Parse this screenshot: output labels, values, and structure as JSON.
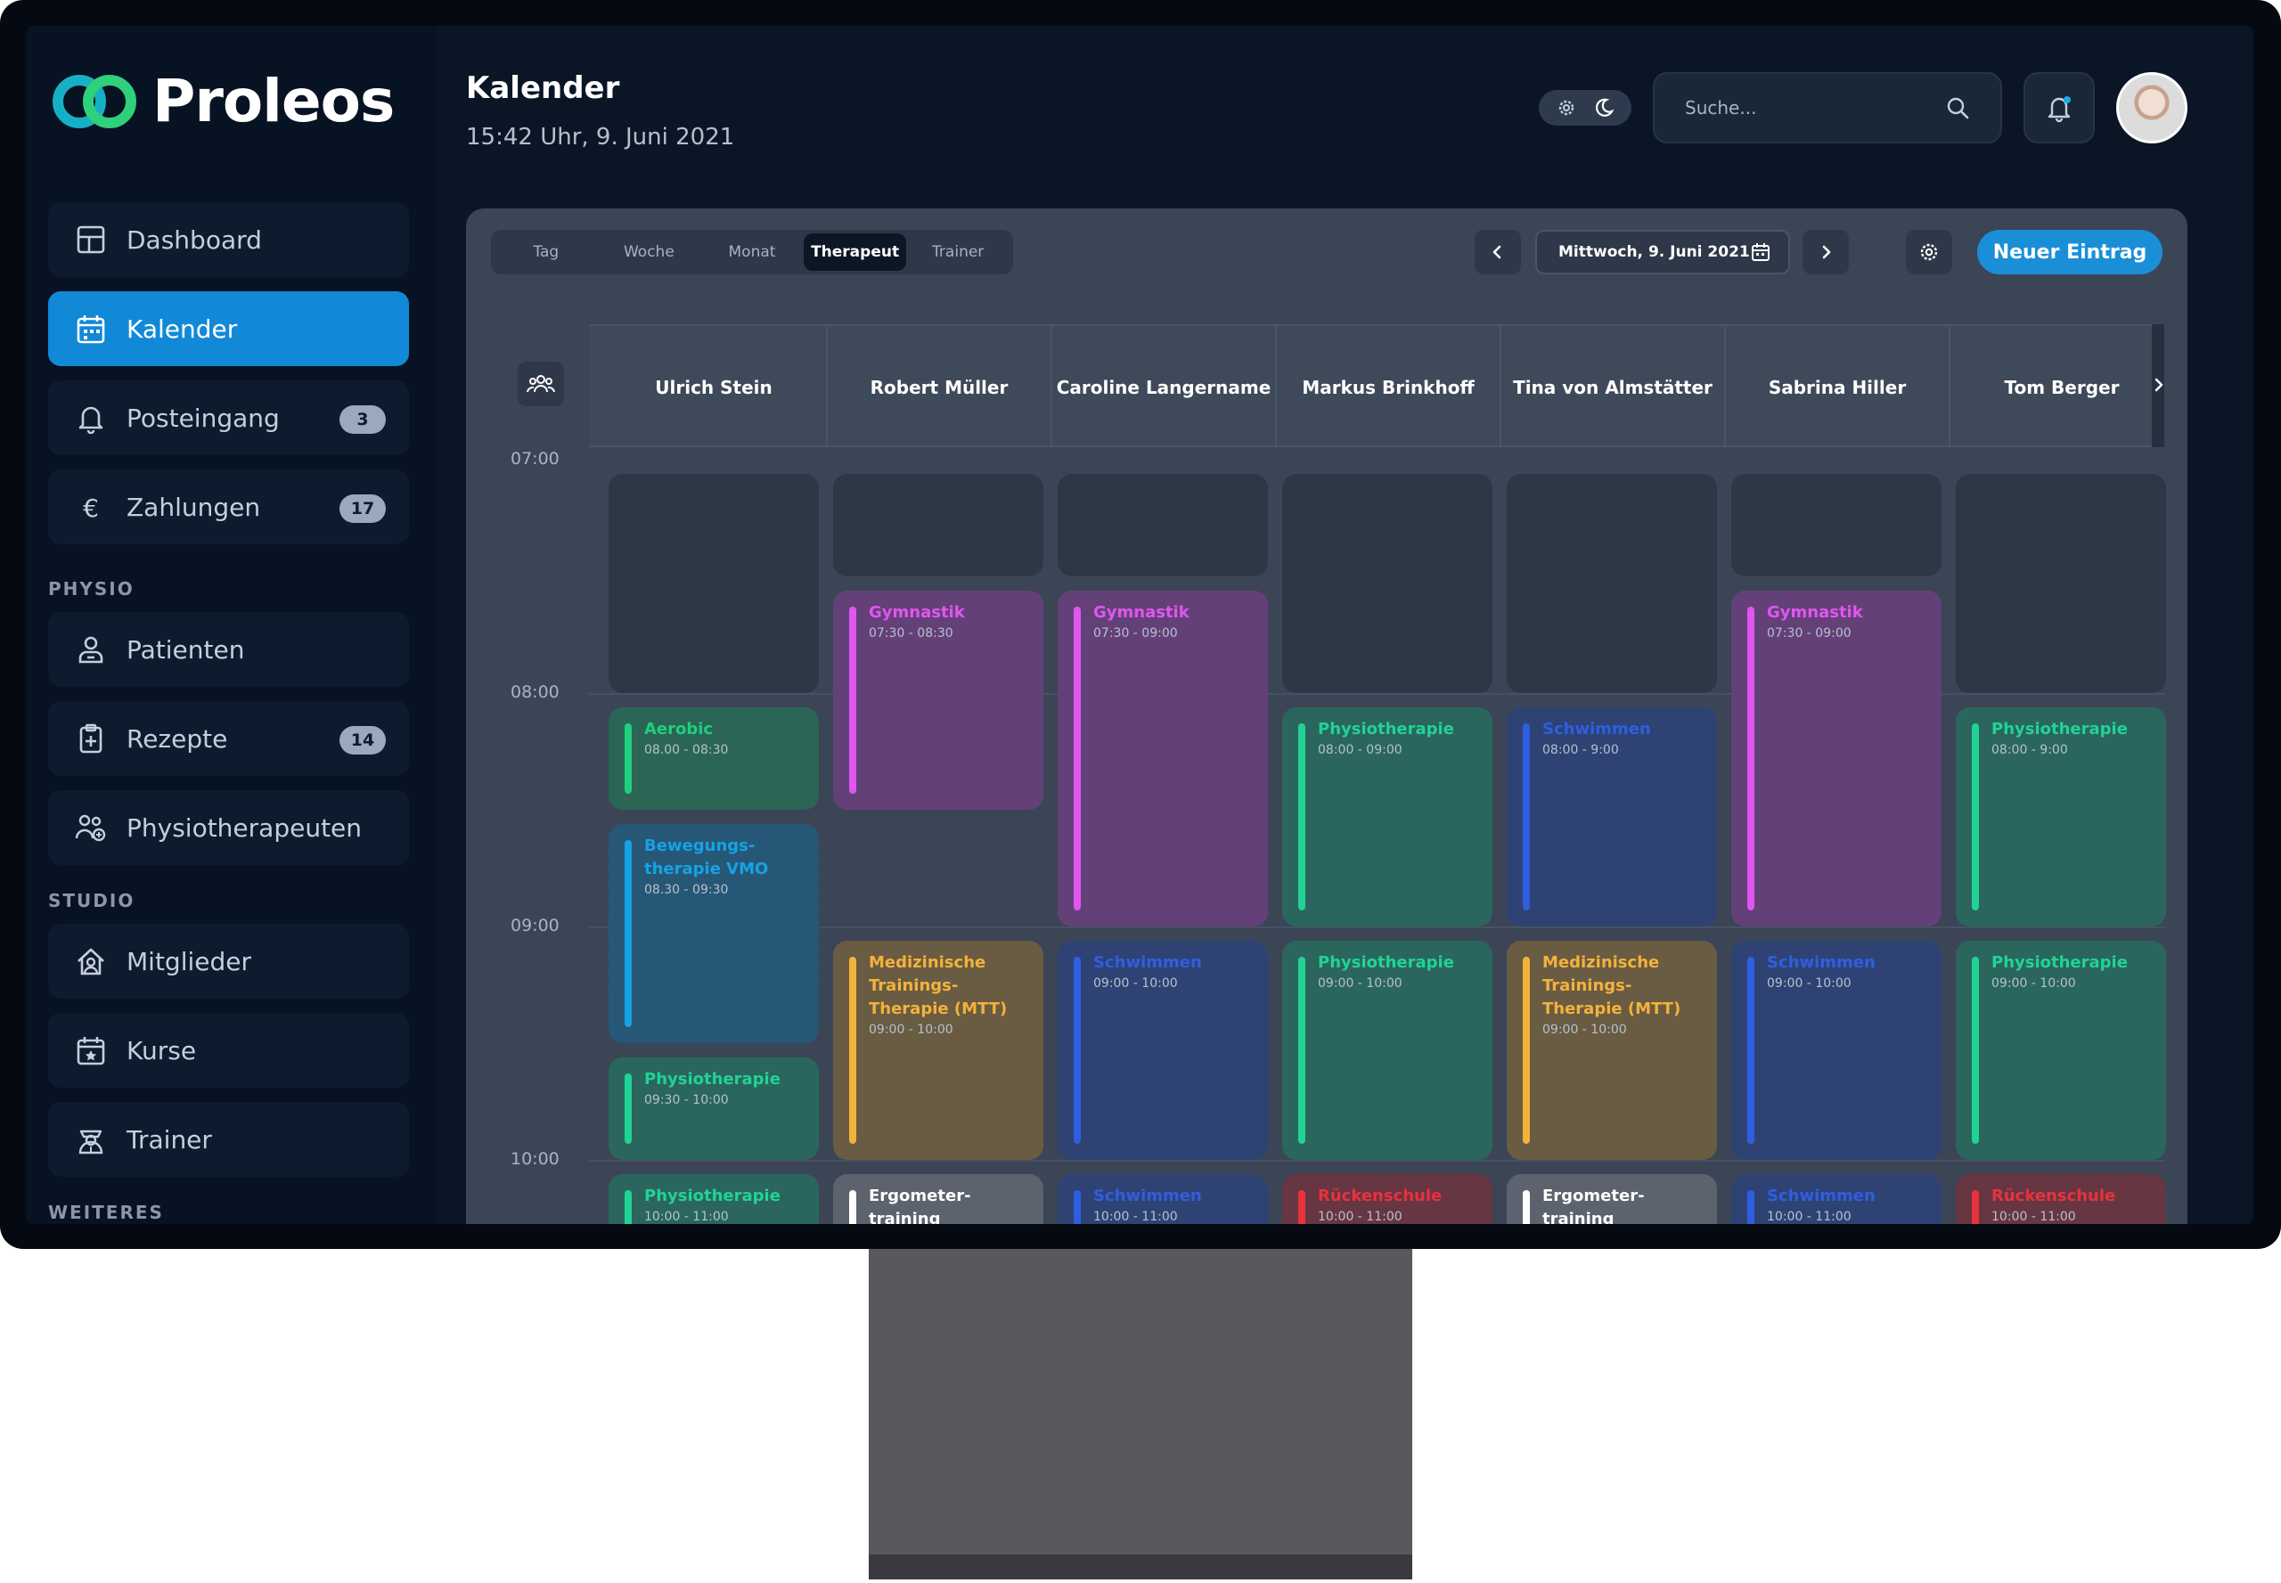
{
  "brand": {
    "name": "Proleos"
  },
  "sidebar": {
    "items": [
      {
        "label": "Dashboard",
        "icon": "grid-icon"
      },
      {
        "label": "Kalender",
        "icon": "calendar-icon",
        "active": true
      },
      {
        "label": "Posteingang",
        "icon": "bell-icon",
        "badge": "3"
      },
      {
        "label": "Zahlungen",
        "icon": "euro-icon",
        "badge": "17"
      }
    ],
    "physio_title": "PHYSIO",
    "physio_items": [
      {
        "label": "Patienten",
        "icon": "patient-icon"
      },
      {
        "label": "Rezepte",
        "icon": "prescription-icon",
        "badge": "14"
      },
      {
        "label": "Physiotherapeuten",
        "icon": "therapist-icon"
      }
    ],
    "studio_title": "STUDIO",
    "studio_items": [
      {
        "label": "Mitglieder",
        "icon": "members-icon"
      },
      {
        "label": "Kurse",
        "icon": "course-icon"
      },
      {
        "label": "Trainer",
        "icon": "trainer-icon"
      }
    ],
    "more_title": "WEITERES"
  },
  "header": {
    "title": "Kalender",
    "subtitle": "15:42 Uhr, 9. Juni 2021",
    "search_placeholder": "Suche..."
  },
  "calendar": {
    "view_tabs": [
      "Tag",
      "Woche",
      "Monat",
      "Therapeut",
      "Trainer"
    ],
    "active_tab": "Therapeut",
    "date": "Mittwoch, 9. Juni 2021",
    "new_entry": "Neuer Eintrag",
    "columns": [
      "Ulrich Stein",
      "Robert Müller",
      "Caroline Langername",
      "Markus Brinkhoff",
      "Tina von Almstätter",
      "Sabrina Hiller",
      "Tom Berger"
    ],
    "times": [
      "07:00",
      "08:00",
      "09:00",
      "10:00"
    ],
    "colors": {
      "green": "#1fcf7e",
      "purple": "#e056f0",
      "blue": "#2f5ee0",
      "cyan": "#16a2e6",
      "orange": "#f3b23c",
      "white": "#ffffff",
      "red": "#e8323c",
      "teal": "#21d395"
    },
    "events": [
      {
        "col": 0,
        "start": 8.0,
        "end": 8.5,
        "title": "Aerobic",
        "hours": "08.00 - 08:30",
        "color": "green"
      },
      {
        "col": 0,
        "start": 8.5,
        "end": 9.5,
        "title": "Bewegungs-therapie VMO",
        "hours": "08.30 - 09:30",
        "color": "cyan"
      },
      {
        "col": 0,
        "start": 9.5,
        "end": 10.0,
        "title": "Physiotherapie",
        "hours": "09:30 - 10:00",
        "color": "teal"
      },
      {
        "col": 0,
        "start": 10.0,
        "end": 11.0,
        "title": "Physiotherapie",
        "hours": "10:00 - 11:00",
        "color": "teal"
      },
      {
        "col": 1,
        "start": 7.5,
        "end": 8.5,
        "title": "Gymnastik",
        "hours": "07:30 - 08:30",
        "color": "purple"
      },
      {
        "col": 1,
        "start": 9.0,
        "end": 10.0,
        "title": "Medizinische Trainings-Therapie (MTT)",
        "hours": "09:00 - 10:00",
        "color": "orange"
      },
      {
        "col": 1,
        "start": 10.0,
        "end": 11.0,
        "title": "Ergometer-training",
        "hours": "",
        "color": "white"
      },
      {
        "col": 2,
        "start": 7.5,
        "end": 9.0,
        "title": "Gymnastik",
        "hours": "07:30 - 09:00",
        "color": "purple"
      },
      {
        "col": 2,
        "start": 9.0,
        "end": 10.0,
        "title": "Schwimmen",
        "hours": "09:00 - 10:00",
        "color": "blue"
      },
      {
        "col": 2,
        "start": 10.0,
        "end": 11.0,
        "title": "Schwimmen",
        "hours": "10:00 - 11:00",
        "color": "blue"
      },
      {
        "col": 3,
        "start": 8.0,
        "end": 9.0,
        "title": "Physiotherapie",
        "hours": "08:00 - 09:00",
        "color": "teal"
      },
      {
        "col": 3,
        "start": 9.0,
        "end": 10.0,
        "title": "Physiotherapie",
        "hours": "09:00 - 10:00",
        "color": "teal"
      },
      {
        "col": 3,
        "start": 10.0,
        "end": 11.0,
        "title": "Rückenschule",
        "hours": "10:00 - 11:00",
        "color": "red"
      },
      {
        "col": 4,
        "start": 8.0,
        "end": 9.0,
        "title": "Schwimmen",
        "hours": "08:00 - 9:00",
        "color": "blue"
      },
      {
        "col": 4,
        "start": 9.0,
        "end": 10.0,
        "title": "Medizinische Trainings-Therapie (MTT)",
        "hours": "09:00 - 10:00",
        "color": "orange"
      },
      {
        "col": 4,
        "start": 10.0,
        "end": 11.0,
        "title": "Ergometer-training",
        "hours": "",
        "color": "white"
      },
      {
        "col": 5,
        "start": 7.5,
        "end": 9.0,
        "title": "Gymnastik",
        "hours": "07:30 - 09:00",
        "color": "purple"
      },
      {
        "col": 5,
        "start": 9.0,
        "end": 10.0,
        "title": "Schwimmen",
        "hours": "09:00 - 10:00",
        "color": "blue"
      },
      {
        "col": 5,
        "start": 10.0,
        "end": 11.0,
        "title": "Schwimmen",
        "hours": "10:00 - 11:00",
        "color": "blue"
      },
      {
        "col": 6,
        "start": 8.0,
        "end": 9.0,
        "title": "Physiotherapie",
        "hours": "08:00 - 9:00",
        "color": "teal"
      },
      {
        "col": 6,
        "start": 9.0,
        "end": 10.0,
        "title": "Physiotherapie",
        "hours": "09:00 - 10:00",
        "color": "teal"
      },
      {
        "col": 6,
        "start": 10.0,
        "end": 11.0,
        "title": "Rückenschule",
        "hours": "10:00 - 11:00",
        "color": "red"
      }
    ],
    "empty_slots": [
      {
        "col": 0,
        "start": 7.0,
        "end": 8.0
      },
      {
        "col": 1,
        "start": 7.0,
        "end": 7.5
      },
      {
        "col": 2,
        "start": 7.0,
        "end": 7.5
      },
      {
        "col": 3,
        "start": 7.0,
        "end": 8.0
      },
      {
        "col": 4,
        "start": 7.0,
        "end": 8.0
      },
      {
        "col": 5,
        "start": 7.0,
        "end": 7.5
      },
      {
        "col": 6,
        "start": 7.0,
        "end": 8.0
      }
    ]
  }
}
